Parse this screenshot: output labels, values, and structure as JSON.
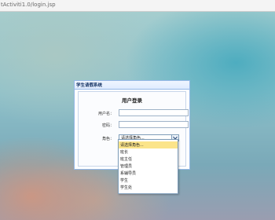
{
  "browser": {
    "url": "tActiviti1.0/login.jsp"
  },
  "panel": {
    "title": "学生请假系统"
  },
  "form": {
    "title": "用户登录",
    "username_label": "用户名：",
    "username_value": "",
    "password_label": "密码：",
    "password_value": "",
    "role_label": "角色：",
    "role_selected": "请选择角色..."
  },
  "role_options": [
    "请选择角色...",
    "班长",
    "班主任",
    "管理员",
    "系辅导员",
    "学生",
    "学生处"
  ]
}
